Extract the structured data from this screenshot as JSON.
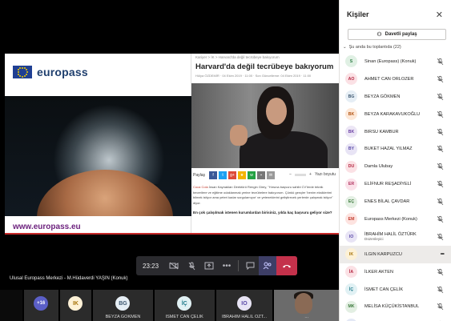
{
  "slide": {
    "brand": "europass",
    "brand_url": "www.europass.eu",
    "breadcrumb": "Kariyer > İK > Harvard'da değil tecrübeye bakıyorum",
    "article_title": "Harvard'da değil tecrübeye bakıyorum",
    "article_meta": "Hülya ÖZDEMİR  ·  04 Ekim 2019  ·  11:00  ·  Son Güncelleme: 04 Ekim 2019  ·  11:00",
    "share_label": "Paylaş",
    "font_minus": "−",
    "font_plus": "+",
    "font_reset": "Yazı boyutu",
    "body_lead": "Coca Cola",
    "body_text": "İnsan Kaynakları Direktörü Rengin Girey, \"Hırsına başvuru sahibi CV'lerde teknik becerilere ve eğitime odaklanmak yerine tecrübelere bakıyorum. Çünkü gençler 'benim eksiklerimi bilmek istiyor ama yeteri kadar sorgulamıyor' ve yeteneklerini geliştirecek yerlerde çalışmak istiyor\" diyor.",
    "body_sub": "En çok çalışılmak istenen kurumlardan birisiniz, yılda kaç başvuru geliyor size?"
  },
  "call": {
    "time": "23:23",
    "presenter": "Ulusal Europass Merkezi - M.Hüdaverdi YAŞIN (Konuk)"
  },
  "strip": {
    "overflow": "+16",
    "tiles": [
      {
        "initials": "IK",
        "name": "",
        "bg": "#fdf1d6",
        "fg": "#a8740a"
      },
      {
        "initials": "BG",
        "name": "BEYZA GÖKMEN",
        "bg": "#e6eef5",
        "fg": "#3e5870"
      },
      {
        "initials": "İÇ",
        "name": "İSMET CAN ÇELİK",
        "bg": "#e1f1f4",
        "fg": "#217b8c"
      },
      {
        "initials": "IO",
        "name": "İBRAHİM HALİL ÖZT...",
        "bg": "#e8e4f5",
        "fg": "#5b4aa8"
      }
    ],
    "video_name": "..."
  },
  "panel": {
    "title": "Kişiler",
    "invite_label": "Davetli paylaş",
    "section_label": "Şu anda bu toplantıda (22)",
    "people": [
      {
        "initials": "S",
        "name": "Sinan (Europass) (Konuk)",
        "sub": "",
        "bg": "#e0f0e4",
        "fg": "#2e7d46",
        "icon": "mic-off"
      },
      {
        "initials": "AO",
        "name": "AHMET CAN ORLOZER",
        "sub": "",
        "bg": "#fbe1e5",
        "fg": "#b3243f",
        "icon": "mic-off"
      },
      {
        "initials": "BG",
        "name": "BEYZA GÖKMEN",
        "sub": "",
        "bg": "#e6eef5",
        "fg": "#3e5870",
        "icon": "mic-off"
      },
      {
        "initials": "BK",
        "name": "BEYZA KARAKAVUKOĞLU",
        "sub": "",
        "bg": "#fde8d8",
        "fg": "#b25312",
        "icon": "mic-off"
      },
      {
        "initials": "BK",
        "name": "BIRSU KAMBUR",
        "sub": "",
        "bg": "#ece6f5",
        "fg": "#6a3fa4",
        "icon": "mic-off"
      },
      {
        "initials": "BY",
        "name": "BUKET HAZAL YILMAZ",
        "sub": "",
        "bg": "#e8e4f5",
        "fg": "#5b4aa8",
        "icon": "mic-off"
      },
      {
        "initials": "DU",
        "name": "Damla Ulubay",
        "sub": "",
        "bg": "#fbe1e5",
        "fg": "#b3243f",
        "icon": "mic-off"
      },
      {
        "initials": "ER",
        "name": "ELİFNUR REŞADİYELİ",
        "sub": "",
        "bg": "#fbe2ea",
        "fg": "#b0335f",
        "icon": "mic-off"
      },
      {
        "initials": "EÇ",
        "name": "ENES BİLAL ÇAVDAR",
        "sub": "",
        "bg": "#e3efe3",
        "fg": "#3d7a3d",
        "icon": "mic-off"
      },
      {
        "initials": "EM",
        "name": "Europass Merkezi (Konuk)",
        "sub": "",
        "bg": "#fde3e0",
        "fg": "#c23a2b",
        "icon": "mic-off"
      },
      {
        "initials": "IO",
        "name": "İBRAHİM HALİL ÖZTÜRK",
        "sub": "Düzenleyici",
        "bg": "#e8e4f5",
        "fg": "#5b4aa8",
        "icon": "mic-off"
      },
      {
        "initials": "IK",
        "name": "ILGIN KARPUZCU",
        "sub": "",
        "bg": "#fdf1d6",
        "fg": "#a8740a",
        "icon": "more"
      },
      {
        "initials": "İA",
        "name": "İLKER AKTEN",
        "sub": "",
        "bg": "#fbe1e5",
        "fg": "#b3243f",
        "icon": "mic-off"
      },
      {
        "initials": "İÇ",
        "name": "İSMET CAN ÇELİK",
        "sub": "",
        "bg": "#e1f1f4",
        "fg": "#217b8c",
        "icon": "mic-off"
      },
      {
        "initials": "MK",
        "name": "MELİSA KÜÇÜKİSTANBUL",
        "sub": "",
        "bg": "#e3efe3",
        "fg": "#3d7a3d",
        "icon": "mic-off"
      },
      {
        "initials": "MK",
        "name": "MİRAY KAYA",
        "sub": "",
        "bg": "#e3e8f5",
        "fg": "#3a57a8",
        "icon": "mic-off"
      }
    ]
  },
  "colors": {
    "teams_purple": "#5b5fc7",
    "hangup_red": "#c4314b",
    "europass_blue": "#1f3f93",
    "europass_purple": "#6b1f7c"
  }
}
